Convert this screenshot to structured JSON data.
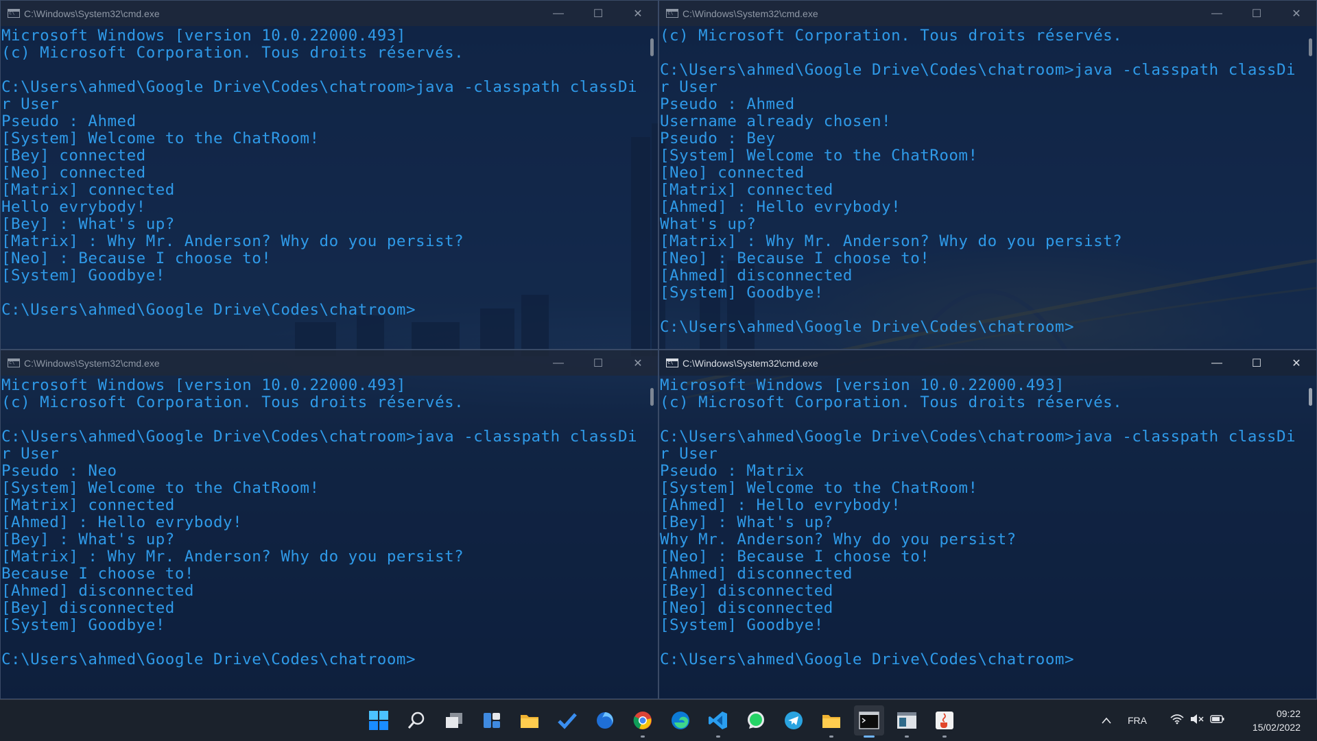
{
  "windows": [
    {
      "title": "C:\\Windows\\System32\\cmd.exe",
      "active": false,
      "lines": [
        "Microsoft Windows [version 10.0.22000.493]",
        "(c) Microsoft Corporation. Tous droits réservés.",
        "",
        "C:\\Users\\ahmed\\Google Drive\\Codes\\chatroom>java -classpath classDi",
        "r User",
        "Pseudo : Ahmed",
        "[System] Welcome to the ChatRoom!",
        "[Bey] connected",
        "[Neo] connected",
        "[Matrix] connected",
        "Hello evrybody!",
        "[Bey] : What's up?",
        "[Matrix] : Why Mr. Anderson? Why do you persist?",
        "[Neo] : Because I choose to!",
        "[System] Goodbye!",
        "",
        "C:\\Users\\ahmed\\Google Drive\\Codes\\chatroom>"
      ]
    },
    {
      "title": "C:\\Windows\\System32\\cmd.exe",
      "active": false,
      "lines": [
        "(c) Microsoft Corporation. Tous droits réservés.",
        "",
        "C:\\Users\\ahmed\\Google Drive\\Codes\\chatroom>java -classpath classDi",
        "r User",
        "Pseudo : Ahmed",
        "Username already chosen!",
        "Pseudo : Bey",
        "[System] Welcome to the ChatRoom!",
        "[Neo] connected",
        "[Matrix] connected",
        "[Ahmed] : Hello evrybody!",
        "What's up?",
        "[Matrix] : Why Mr. Anderson? Why do you persist?",
        "[Neo] : Because I choose to!",
        "[Ahmed] disconnected",
        "[System] Goodbye!",
        "",
        "C:\\Users\\ahmed\\Google Drive\\Codes\\chatroom>"
      ]
    },
    {
      "title": "C:\\Windows\\System32\\cmd.exe",
      "active": false,
      "lines": [
        "Microsoft Windows [version 10.0.22000.493]",
        "(c) Microsoft Corporation. Tous droits réservés.",
        "",
        "C:\\Users\\ahmed\\Google Drive\\Codes\\chatroom>java -classpath classDi",
        "r User",
        "Pseudo : Neo",
        "[System] Welcome to the ChatRoom!",
        "[Matrix] connected",
        "[Ahmed] : Hello evrybody!",
        "[Bey] : What's up?",
        "[Matrix] : Why Mr. Anderson? Why do you persist?",
        "Because I choose to!",
        "[Ahmed] disconnected",
        "[Bey] disconnected",
        "[System] Goodbye!",
        "",
        "C:\\Users\\ahmed\\Google Drive\\Codes\\chatroom>"
      ]
    },
    {
      "title": "C:\\Windows\\System32\\cmd.exe",
      "active": true,
      "lines": [
        "Microsoft Windows [version 10.0.22000.493]",
        "(c) Microsoft Corporation. Tous droits réservés.",
        "",
        "C:\\Users\\ahmed\\Google Drive\\Codes\\chatroom>java -classpath classDi",
        "r User",
        "Pseudo : Matrix",
        "[System] Welcome to the ChatRoom!",
        "[Ahmed] : Hello evrybody!",
        "[Bey] : What's up?",
        "Why Mr. Anderson? Why do you persist?",
        "[Neo] : Because I choose to!",
        "[Ahmed] disconnected",
        "[Bey] disconnected",
        "[Neo] disconnected",
        "[System] Goodbye!",
        "",
        "C:\\Users\\ahmed\\Google Drive\\Codes\\chatroom>"
      ]
    }
  ],
  "caption_buttons": {
    "minimize": "—",
    "maximize": "☐",
    "close": "✕"
  },
  "taskbar": {
    "apps": [
      {
        "name": "start-button",
        "icon": "windows-logo-icon",
        "running": false,
        "active": false
      },
      {
        "name": "search-button",
        "icon": "search-icon",
        "running": false,
        "active": false
      },
      {
        "name": "task-view-button",
        "icon": "task-view-icon",
        "running": false,
        "active": false
      },
      {
        "name": "widgets-button",
        "icon": "widgets-icon",
        "running": false,
        "active": false
      },
      {
        "name": "file-explorer-app",
        "icon": "folder-icon",
        "running": false,
        "active": false
      },
      {
        "name": "todo-app",
        "icon": "checkmark-icon",
        "running": false,
        "active": false
      },
      {
        "name": "firefox-app",
        "icon": "firefox-icon",
        "running": false,
        "active": false
      },
      {
        "name": "chrome-app",
        "icon": "chrome-icon",
        "running": true,
        "active": false
      },
      {
        "name": "edge-app",
        "icon": "edge-icon",
        "running": false,
        "active": false
      },
      {
        "name": "vscode-app",
        "icon": "vscode-icon",
        "running": true,
        "active": false
      },
      {
        "name": "whatsapp-app",
        "icon": "whatsapp-icon",
        "running": false,
        "active": false
      },
      {
        "name": "telegram-app",
        "icon": "telegram-icon",
        "running": false,
        "active": false
      },
      {
        "name": "folder-app",
        "icon": "folder-icon",
        "running": true,
        "active": false
      },
      {
        "name": "cmd-app",
        "icon": "terminal-icon",
        "running": true,
        "active": true
      },
      {
        "name": "console-window-app",
        "icon": "window-icon",
        "running": true,
        "active": false
      },
      {
        "name": "java-app",
        "icon": "java-icon",
        "running": true,
        "active": false
      }
    ],
    "tray": {
      "chevron": "^",
      "language": "FRA",
      "time": "09:22",
      "date": "15/02/2022"
    }
  },
  "colors": {
    "terminal_text": "#2f9ae8",
    "taskbar_bg": "#1c222c",
    "accent": "#6fb5ff"
  }
}
